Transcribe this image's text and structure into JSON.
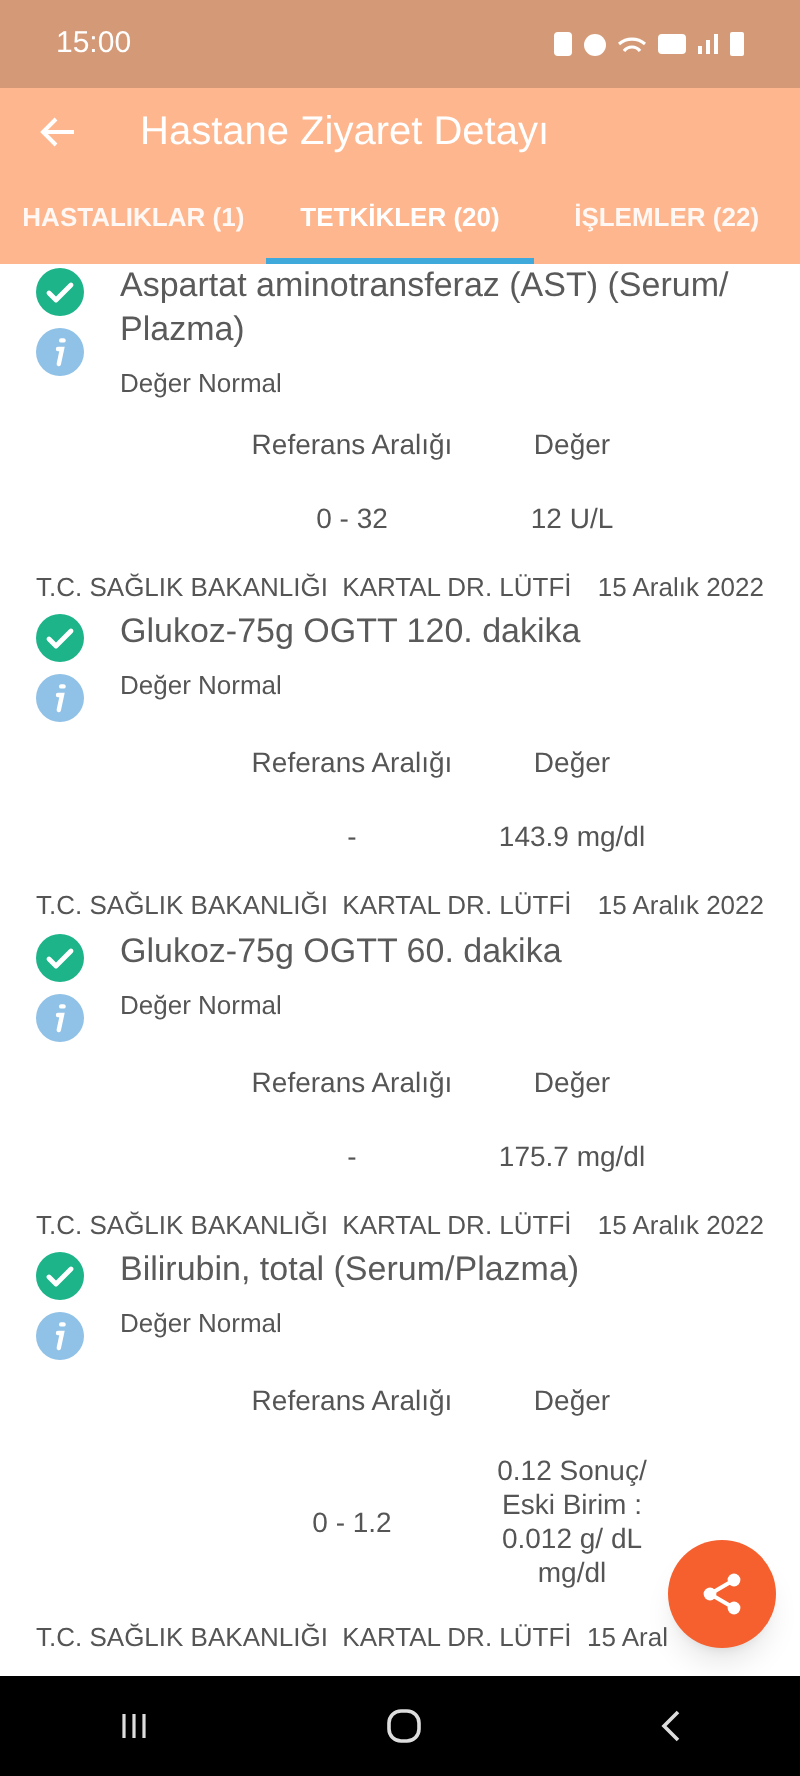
{
  "status_bar": {
    "time": "15:00"
  },
  "app_bar": {
    "title": "Hastane Ziyaret Detayı"
  },
  "tabs": [
    {
      "label": "HASTALIKLAR (1)",
      "selected": false
    },
    {
      "label": "TETKİKLER (20)",
      "selected": true
    },
    {
      "label": "İŞLEMLER (22)",
      "selected": false
    }
  ],
  "results": [
    {
      "title": "Aspartat aminotransferaz (AST) (Serum/ Plazma)",
      "normal": true,
      "status": "Değer Normal",
      "range_label": "Referans Aralığı",
      "value_label": "Değer",
      "range": "0 - 32",
      "value": "12 U/L"
    },
    {
      "institution": "T.C. SAĞLIK BAKANLIĞI  KARTAL DR. LÜTFİ",
      "date": "15 Aralık 2022",
      "title": "Glukoz-75g OGTT 120. dakika",
      "normal": true,
      "status": "Değer Normal",
      "range_label": "Referans Aralığı",
      "value_label": "Değer",
      "range": "-",
      "value": "143.9 mg/dl"
    },
    {
      "institution": "T.C. SAĞLIK BAKANLIĞI  KARTAL DR. LÜTFİ",
      "date": "15 Aralık 2022",
      "title": "Glukoz-75g OGTT 60. dakika",
      "normal": true,
      "status": "Değer Normal",
      "range_label": "Referans Aralığı",
      "value_label": "Değer",
      "range": "-",
      "value": "175.7 mg/dl"
    },
    {
      "institution": "T.C. SAĞLIK BAKANLIĞI  KARTAL DR. LÜTFİ",
      "date": "15 Aralık 2022",
      "title": "Bilirubin, total (Serum/Plazma)",
      "normal": true,
      "status": "Değer Normal",
      "range_label": "Referans Aralığı",
      "value_label": "Değer",
      "range": "0 - 1.2",
      "value": "0.12 Sonuç/ Eski Birim : 0.012 g/ dL mg/dl"
    },
    {
      "institution": "T.C. SAĞLIK BAKANLIĞI  KARTAL DR. LÜTFİ",
      "date": "15 Aral"
    }
  ]
}
